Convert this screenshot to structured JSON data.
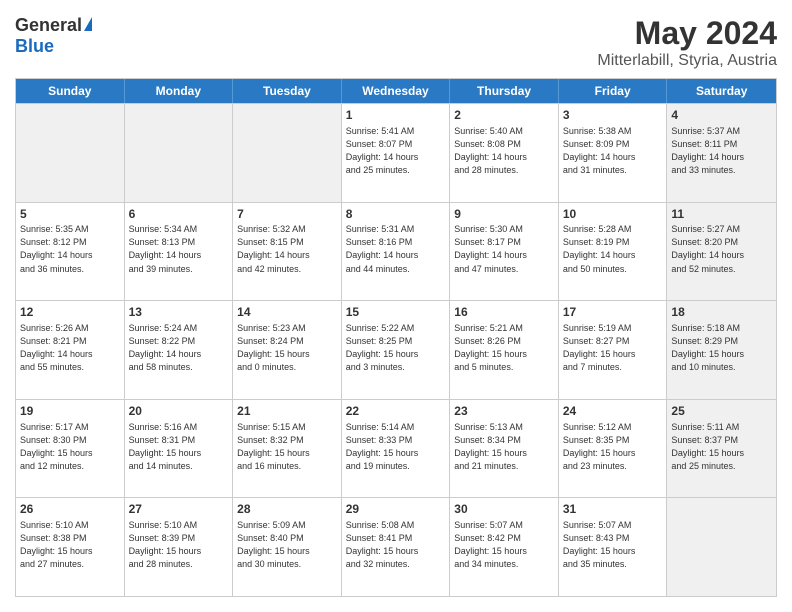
{
  "header": {
    "logo_general": "General",
    "logo_blue": "Blue",
    "month_title": "May 2024",
    "subtitle": "Mitterlabill, Styria, Austria"
  },
  "days_of_week": [
    "Sunday",
    "Monday",
    "Tuesday",
    "Wednesday",
    "Thursday",
    "Friday",
    "Saturday"
  ],
  "rows": [
    [
      {
        "day": "",
        "info": "",
        "shaded": true
      },
      {
        "day": "",
        "info": "",
        "shaded": true
      },
      {
        "day": "",
        "info": "",
        "shaded": true
      },
      {
        "day": "1",
        "info": "Sunrise: 5:41 AM\nSunset: 8:07 PM\nDaylight: 14 hours\nand 25 minutes."
      },
      {
        "day": "2",
        "info": "Sunrise: 5:40 AM\nSunset: 8:08 PM\nDaylight: 14 hours\nand 28 minutes."
      },
      {
        "day": "3",
        "info": "Sunrise: 5:38 AM\nSunset: 8:09 PM\nDaylight: 14 hours\nand 31 minutes."
      },
      {
        "day": "4",
        "info": "Sunrise: 5:37 AM\nSunset: 8:11 PM\nDaylight: 14 hours\nand 33 minutes.",
        "shaded": true
      }
    ],
    [
      {
        "day": "5",
        "info": "Sunrise: 5:35 AM\nSunset: 8:12 PM\nDaylight: 14 hours\nand 36 minutes."
      },
      {
        "day": "6",
        "info": "Sunrise: 5:34 AM\nSunset: 8:13 PM\nDaylight: 14 hours\nand 39 minutes."
      },
      {
        "day": "7",
        "info": "Sunrise: 5:32 AM\nSunset: 8:15 PM\nDaylight: 14 hours\nand 42 minutes."
      },
      {
        "day": "8",
        "info": "Sunrise: 5:31 AM\nSunset: 8:16 PM\nDaylight: 14 hours\nand 44 minutes."
      },
      {
        "day": "9",
        "info": "Sunrise: 5:30 AM\nSunset: 8:17 PM\nDaylight: 14 hours\nand 47 minutes."
      },
      {
        "day": "10",
        "info": "Sunrise: 5:28 AM\nSunset: 8:19 PM\nDaylight: 14 hours\nand 50 minutes."
      },
      {
        "day": "11",
        "info": "Sunrise: 5:27 AM\nSunset: 8:20 PM\nDaylight: 14 hours\nand 52 minutes.",
        "shaded": true
      }
    ],
    [
      {
        "day": "12",
        "info": "Sunrise: 5:26 AM\nSunset: 8:21 PM\nDaylight: 14 hours\nand 55 minutes."
      },
      {
        "day": "13",
        "info": "Sunrise: 5:24 AM\nSunset: 8:22 PM\nDaylight: 14 hours\nand 58 minutes."
      },
      {
        "day": "14",
        "info": "Sunrise: 5:23 AM\nSunset: 8:24 PM\nDaylight: 15 hours\nand 0 minutes."
      },
      {
        "day": "15",
        "info": "Sunrise: 5:22 AM\nSunset: 8:25 PM\nDaylight: 15 hours\nand 3 minutes."
      },
      {
        "day": "16",
        "info": "Sunrise: 5:21 AM\nSunset: 8:26 PM\nDaylight: 15 hours\nand 5 minutes."
      },
      {
        "day": "17",
        "info": "Sunrise: 5:19 AM\nSunset: 8:27 PM\nDaylight: 15 hours\nand 7 minutes."
      },
      {
        "day": "18",
        "info": "Sunrise: 5:18 AM\nSunset: 8:29 PM\nDaylight: 15 hours\nand 10 minutes.",
        "shaded": true
      }
    ],
    [
      {
        "day": "19",
        "info": "Sunrise: 5:17 AM\nSunset: 8:30 PM\nDaylight: 15 hours\nand 12 minutes."
      },
      {
        "day": "20",
        "info": "Sunrise: 5:16 AM\nSunset: 8:31 PM\nDaylight: 15 hours\nand 14 minutes."
      },
      {
        "day": "21",
        "info": "Sunrise: 5:15 AM\nSunset: 8:32 PM\nDaylight: 15 hours\nand 16 minutes."
      },
      {
        "day": "22",
        "info": "Sunrise: 5:14 AM\nSunset: 8:33 PM\nDaylight: 15 hours\nand 19 minutes."
      },
      {
        "day": "23",
        "info": "Sunrise: 5:13 AM\nSunset: 8:34 PM\nDaylight: 15 hours\nand 21 minutes."
      },
      {
        "day": "24",
        "info": "Sunrise: 5:12 AM\nSunset: 8:35 PM\nDaylight: 15 hours\nand 23 minutes."
      },
      {
        "day": "25",
        "info": "Sunrise: 5:11 AM\nSunset: 8:37 PM\nDaylight: 15 hours\nand 25 minutes.",
        "shaded": true
      }
    ],
    [
      {
        "day": "26",
        "info": "Sunrise: 5:10 AM\nSunset: 8:38 PM\nDaylight: 15 hours\nand 27 minutes."
      },
      {
        "day": "27",
        "info": "Sunrise: 5:10 AM\nSunset: 8:39 PM\nDaylight: 15 hours\nand 28 minutes."
      },
      {
        "day": "28",
        "info": "Sunrise: 5:09 AM\nSunset: 8:40 PM\nDaylight: 15 hours\nand 30 minutes."
      },
      {
        "day": "29",
        "info": "Sunrise: 5:08 AM\nSunset: 8:41 PM\nDaylight: 15 hours\nand 32 minutes."
      },
      {
        "day": "30",
        "info": "Sunrise: 5:07 AM\nSunset: 8:42 PM\nDaylight: 15 hours\nand 34 minutes."
      },
      {
        "day": "31",
        "info": "Sunrise: 5:07 AM\nSunset: 8:43 PM\nDaylight: 15 hours\nand 35 minutes."
      },
      {
        "day": "",
        "info": "",
        "shaded": true
      }
    ]
  ]
}
